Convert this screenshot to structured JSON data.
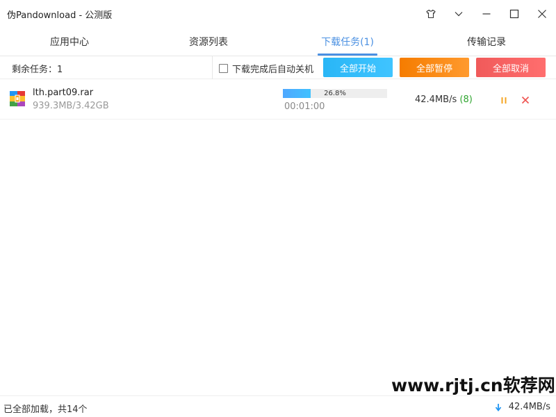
{
  "window": {
    "title": "伪Pandownload - 公测版"
  },
  "tabs": [
    {
      "label": "应用中心",
      "active": false
    },
    {
      "label": "资源列表",
      "active": false
    },
    {
      "label": "下载任务(1)",
      "active": true
    },
    {
      "label": "传输记录",
      "active": false
    }
  ],
  "toolbar": {
    "remaining": "剩余任务：1",
    "shutdown_label": "下载完成后自动关机",
    "shutdown_checked": false,
    "start_all": "全部开始",
    "pause_all": "全部暂停",
    "cancel_all": "全部取消"
  },
  "downloads": [
    {
      "file_name": "lth.part09.rar",
      "size": "939.3MB/3.42GB",
      "progress_text": "26.8%",
      "progress": 0.268,
      "elapsed": "00:01:00",
      "speed": "42.4MB/s",
      "threads": "(8)",
      "icon": "rar-archive-icon"
    }
  ],
  "watermark": "www.rjtj.cn软荐网",
  "status": {
    "left": "已全部加载，共14个",
    "speed": "42.4MB/s"
  },
  "colors": {
    "accent": "#4a90e2",
    "start": "#29b6f6",
    "pause": "#f57c00",
    "cancel": "#f05a5a",
    "threads": "#2fa52f"
  }
}
